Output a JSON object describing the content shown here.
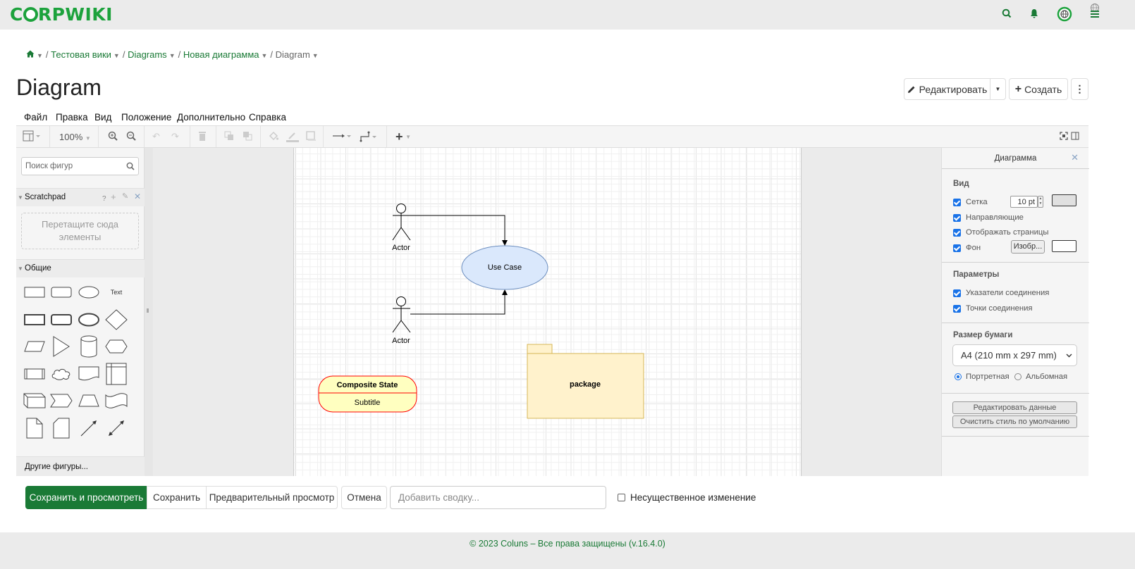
{
  "header": {
    "logo": "CORPWIKI",
    "icons": [
      "search-icon",
      "bell-icon",
      "globe-icon",
      "menu-icon"
    ]
  },
  "breadcrumb": {
    "home_icon": "home-icon",
    "items": [
      "Тестовая вики",
      "Diagrams",
      "Новая диаграмма",
      "Diagram"
    ]
  },
  "page": {
    "title": "Diagram",
    "edit_label": "Редактировать",
    "create_label": "Создать"
  },
  "editor": {
    "menu": [
      "Файл",
      "Правка",
      "Вид",
      "Положение",
      "Дополнительно",
      "Справка"
    ],
    "toolbar": {
      "zoom": "100%",
      "buttons": [
        "format-panel-toggle",
        "zoom-in",
        "zoom-out",
        "undo",
        "redo",
        "delete",
        "to-front",
        "to-back",
        "fill-color",
        "line-color",
        "shadow",
        "connection",
        "waypoints",
        "insert",
        "fullscreen",
        "toggle-panel"
      ]
    },
    "sidebar": {
      "search_placeholder": "Поиск фигур",
      "scratchpad_title": "Scratchpad",
      "scratchpad_help": "?",
      "drop_hint": "Перетащите сюда элементы",
      "general_title": "Общие",
      "text_shape_label": "Text",
      "more_shapes": "Другие фигуры..."
    },
    "diagram": {
      "actor1_label": "Actor",
      "actor2_label": "Actor",
      "usecase_label": "Use Case",
      "state_title": "Composite State",
      "state_subtitle": "Subtitle",
      "package_label": "package",
      "colors": {
        "usecase_fill": "#dae8fc",
        "usecase_stroke": "#6c8ebf",
        "state_fill": "#ffffc0",
        "state_stroke": "#ff0000",
        "package_fill": "#fff2cc",
        "package_stroke": "#d6b656"
      }
    },
    "format_panel": {
      "title": "Диаграмма",
      "view_heading": "Вид",
      "grid_label": "Сетка",
      "grid_size": "10 pt",
      "guides_label": "Направляющие",
      "show_pages_label": "Отображать страницы",
      "background_label": "Фон",
      "image_button": "Изобр...",
      "options_heading": "Параметры",
      "connection_arrows": "Указатели соединения",
      "connection_points": "Точки соединения",
      "paper_heading": "Размер бумаги",
      "paper_size": "A4 (210 mm x 297 mm)",
      "portrait": "Портретная",
      "landscape": "Альбомная",
      "orientation": "portrait",
      "edit_data": "Редактировать данные",
      "clear_style": "Очистить стиль по умолчанию"
    }
  },
  "actions": {
    "save_view": "Сохранить и просмотреть",
    "save": "Сохранить",
    "preview": "Предварительный просмотр",
    "cancel": "Отмена",
    "summary_placeholder": "Добавить сводку...",
    "minor_edit": "Несущественное изменение"
  },
  "footer": {
    "text": "© 2023 Coluns – Все права защищены (v.16.4.0)"
  }
}
